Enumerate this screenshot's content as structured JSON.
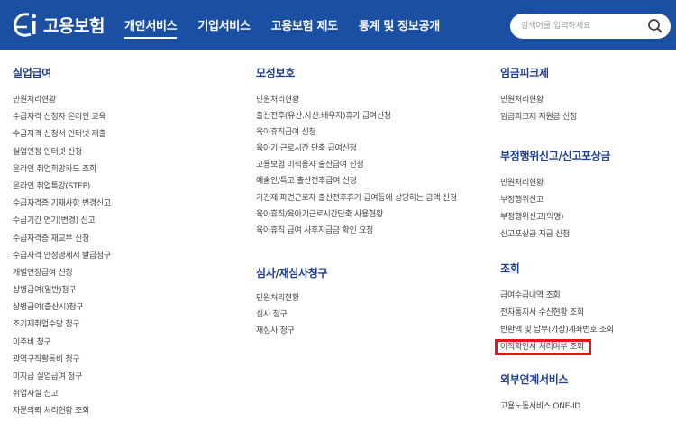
{
  "header": {
    "logo_text": "고용보험",
    "nav": [
      {
        "label": "개인서비스",
        "active": true
      },
      {
        "label": "기업서비스",
        "active": false
      },
      {
        "label": "고용보험 제도",
        "active": false
      },
      {
        "label": "통계 및 정보공개",
        "active": false
      }
    ],
    "search": {
      "placeholder": "검색어를 입력하세요"
    }
  },
  "col1": {
    "title": "실업급여",
    "items": [
      "민원처리현황",
      "수급자격 신청자 온라인 교육",
      "수급자격 신청서 인터넷 제출",
      "실업인정 인터넷 신청",
      "온라인 취업희망카드 조회",
      "온라인 취업특강(STEP)",
      "수급자격증 기재사항 변경신고",
      "수급기간 연기(변경) 신고",
      "수급자격증 재교부 신청",
      "수급자격 안정영세서 발급청구",
      "개별연장급여 신청",
      "상병급여(일반)청구",
      "상병급여(출산시)청구",
      "조기재취업수당 청구",
      "이주비 청구",
      "광역구직활동비 청구",
      "미지급 실업급여 청구",
      "취업사실 신고",
      "자문의뢰 처리현황 조회"
    ]
  },
  "col2": {
    "sections": [
      {
        "title": "모성보호",
        "items": [
          "민원처리현황",
          "출산전후(유산.사산.배우자)휴가 급여신청",
          "육아휴직급여 신청",
          "육아기 근로시간 단축 급여신청",
          "고용보험 미적용자 출산급여 신청",
          "예술인/특고 출산전후급여 신청",
          "기간제.파견근로자 출산전후휴가 급여등에 상당하는 금액 신청",
          "육아휴직/육아기근로시간단축 사용현황",
          "육아휴직 급여 사후지급금 확인 요청"
        ]
      },
      {
        "title": "심사/재심사청구",
        "items": [
          "민원처리현황",
          "심사 청구",
          "재심사 청구"
        ]
      }
    ]
  },
  "col3": {
    "sections": [
      {
        "title": "임금피크제",
        "items": [
          "민원처리현황",
          "임금피크제 지원금 신청"
        ]
      },
      {
        "title": "부정행위신고/신고포상금",
        "items": [
          "민원처리현황",
          "부정행위신고",
          "부정행위신고(익명)",
          "신고포상금 지급 신청"
        ]
      },
      {
        "title": "조회",
        "items": [
          "급여수급내역 조회",
          "전자통지서 수신현황 조회",
          "반환액 및 납부(가상)계좌번호 조회",
          "이직확인서 처리여부 조회"
        ],
        "highlighted_item": "이직확인서 처리여부 조회"
      },
      {
        "title": "외부연계서비스",
        "items": [
          "고용노동서비스 ONE-ID"
        ]
      }
    ]
  },
  "colors": {
    "header_bg": "#1a4fa1",
    "title": "#1f3f8f",
    "highlight": "#e8131b"
  }
}
